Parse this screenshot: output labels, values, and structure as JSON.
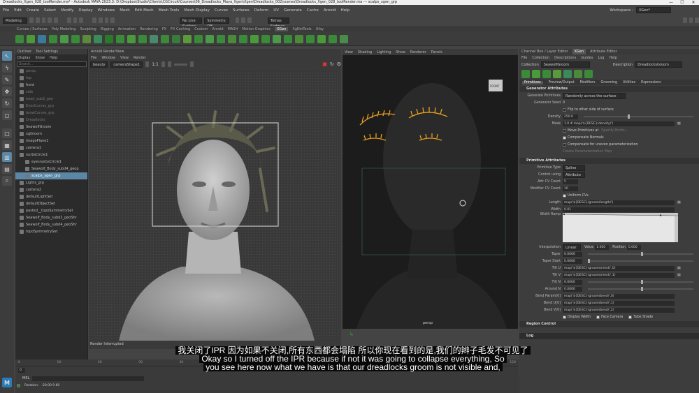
{
  "window": {
    "title": "Dreadlocks_Xgen_028_toolRender.ma* - Autodesk MAYA 2023.3: D:\\Dropbox\\Studio\\Clients\\CGCircuit\\Courses\\06_Dreadlocks_Maya_Xgen\\Xgen\\Dreadlocks_002\\scenes\\Dreadlocks_Xgen_028_toolRender.ma  ---  scalps_xgen_grp",
    "controls": [
      "—",
      "☐",
      "✕"
    ]
  },
  "menubar": {
    "items": [
      "File",
      "Edit",
      "Create",
      "Select",
      "Modify",
      "Display",
      "Windows",
      "Mesh",
      "Edit Mesh",
      "Mesh Tools",
      "Mesh Display",
      "Curves",
      "Surfaces",
      "Deform",
      "UV",
      "Generate",
      "Cache",
      "Arnold",
      "Help"
    ],
    "workspace_label": "Workspace :",
    "workspace_value": "XGen*"
  },
  "statusline": {
    "mode": "Modeling",
    "surface": "No Live Surface",
    "symmetry": "Symmetry: Off",
    "user": "Tomas Sedman"
  },
  "shelf_tabs": [
    "Curves / Surfaces",
    "Poly Modeling",
    "Sculpting",
    "Rigging",
    "Animation",
    "Rendering",
    "FX",
    "FX Caching",
    "Custom",
    "Arnold",
    "MASH",
    "Motion Graphics",
    "XGen",
    "XgNstTools",
    "Ufay"
  ],
  "shelf_active_tab": "XGen",
  "outliner": {
    "tabs": [
      "Outliner",
      "Tool Settings"
    ],
    "menu": [
      "Display",
      "Show",
      "Help"
    ],
    "search_placeholder": "Search...",
    "items": [
      {
        "label": "persp",
        "dim": true,
        "indent": 0
      },
      {
        "label": "top",
        "dim": true,
        "indent": 0
      },
      {
        "label": "front",
        "dim": false,
        "indent": 0
      },
      {
        "label": "side",
        "dim": true,
        "indent": 0
      },
      {
        "label": "head_sub3_geo",
        "dim": true,
        "indent": 0
      },
      {
        "label": "EyesCurves_grp",
        "dim": true,
        "indent": 0
      },
      {
        "label": "browCurves_grp",
        "dim": true,
        "indent": 0
      },
      {
        "label": "Dreadlocks",
        "dim": true,
        "indent": 0
      },
      {
        "label": "SeawolfGroom",
        "dim": false,
        "indent": 0
      },
      {
        "label": "xgGroom",
        "dim": false,
        "indent": 0
      },
      {
        "label": "imagePlane1",
        "dim": false,
        "indent": 0
      },
      {
        "label": "camera1",
        "dim": false,
        "indent": 0
      },
      {
        "label": "nurbsCircle1",
        "dim": false,
        "indent": 0
      },
      {
        "label": "eyesnurbsCircle1",
        "dim": false,
        "indent": 1
      },
      {
        "label": "Seawolf_Body_subd4_geop",
        "dim": false,
        "indent": 1
      },
      {
        "label": "scalps_xgen_grp",
        "dim": false,
        "indent": 1,
        "sel": true
      },
      {
        "label": "Lights_grp",
        "dim": false,
        "indent": 0
      },
      {
        "label": "camera2",
        "dim": false,
        "indent": 0
      },
      {
        "label": "defaultLightSet",
        "dim": false,
        "indent": 0
      },
      {
        "label": "defaultObjectSet",
        "dim": false,
        "indent": 0
      },
      {
        "label": "pasted__topoSymmetrySet",
        "dim": false,
        "indent": 0
      },
      {
        "label": "Seawolf_Body_subd2_geoShr",
        "dim": false,
        "indent": 0
      },
      {
        "label": "Seawolf_Body_subd4_geoShr",
        "dim": false,
        "indent": 0
      },
      {
        "label": "topoSymmetrySet",
        "dim": false,
        "indent": 0
      }
    ]
  },
  "render_view": {
    "title": "Arnold RenderView",
    "menu": [
      "File",
      "Window",
      "View",
      "Render"
    ],
    "aov": "beauty",
    "camera": "cameraShape1",
    "ratio": "1:1",
    "status": "Render Interrupted"
  },
  "viewport": {
    "menu": [
      "View",
      "Shading",
      "Lighting",
      "Show",
      "Renderer",
      "Panels"
    ],
    "label": "persp",
    "cube": "FRONT"
  },
  "xgen": {
    "tabs": [
      "Channel Box / Layer Editor",
      "XGen",
      "Attribute Editor"
    ],
    "menu": [
      "File",
      "Collection",
      "Descriptions",
      "Guides",
      "Log",
      "Help"
    ],
    "collection_label": "Collection",
    "collection": "SeawolfGroom",
    "description_label": "Description",
    "description": "DreadlocksGroom",
    "subtabs": [
      "Primitives",
      "Preview/Output",
      "Modifiers",
      "Grooming",
      "Utilities",
      "Expressions"
    ],
    "gen_section": "Generator Attributes",
    "generate_primitives_label": "Generate Primitives",
    "generate_primitives": "Randomly across the surface",
    "gen_seed_label": "Generator Seed",
    "gen_seed": "0",
    "flip_label": "Flip to other side of surface",
    "density_label": "Density",
    "density": "250.0",
    "mask_label": "Mask",
    "mask": "1.0 # map('${DESC}/density/')",
    "move_label": "Move Primitives at",
    "specify_label": "Specify Points...",
    "comp_normals": "Compensate Normals",
    "comp_uneven": "Compensate for uneven parameterization",
    "create_param": "Create Parameterization Map",
    "prim_section": "Primitive Attributes",
    "prim_type_label": "Primitive Type",
    "prim_type": "Spline",
    "control_label": "Control using",
    "control": "Attribute",
    "attr_cv_label": "Attr CV Count",
    "attr_cv": "5",
    "mod_cv_label": "Modifier CV Count",
    "mod_cv": "10",
    "uniform_label": "Uniform CVs",
    "length_label": "Length",
    "length": "map('${DESC}/groom/length/')",
    "width_label": "Width",
    "width": "0.01",
    "ramp_label": "Width Ramp",
    "interp_label": "Interpolation",
    "interp": "Linear",
    "value_label": "Value",
    "value": "1.000",
    "position_label": "Position",
    "position": "0.000",
    "taper_label": "Taper",
    "taper": "0.0000",
    "taper_start_label": "Taper Start",
    "taper_start": "0.0000",
    "tilt_u_label": "Tilt U",
    "tilt_u": "map('${DESC}/groom/orient/',0)",
    "tilt_v_label": "Tilt V",
    "tilt_v": "map('${DESC}/groom/orient/',1)",
    "tilt_n_label": "Tilt N",
    "tilt_n": "0.0000",
    "around_n_label": "Around N",
    "around_n": "0.0000",
    "bend0_label": "Bend Param[0]",
    "bend0": "map('${DESC}/groom/bend/',0)",
    "bend1_label": "Bend U[0]",
    "bend1": "map('${DESC}/groom/bend/',1)",
    "bend2_label": "Bend V[0]",
    "bend2": "map('${DESC}/groom/bend/',2)",
    "display_width": "Display Width",
    "face_camera": "Face Camera",
    "tube_shade": "Tube Shade",
    "region_section": "Region Control",
    "log": "Log"
  },
  "timeline": {
    "ticks": [
      "0",
      "10",
      "20",
      "30",
      "40",
      "50",
      "60",
      "70",
      "80",
      "90",
      "100",
      "110",
      "120"
    ],
    "start": "0"
  },
  "cmd": {
    "mel": "MEL",
    "rotation_label": "Rotation:",
    "rotation": "-20.00    9.60"
  },
  "subtitles": {
    "zh": "我关闭了IPR 因为如果不关闭,所有东西都会塌陷 所以你现在看到的是,我们的辫子毛发不可见了",
    "en1": "Okay so I turned off the IPR because if not it was going to collapse everything, So",
    "en2": "you see here now what we have is that our dreadlocks groom is not visible and,"
  }
}
